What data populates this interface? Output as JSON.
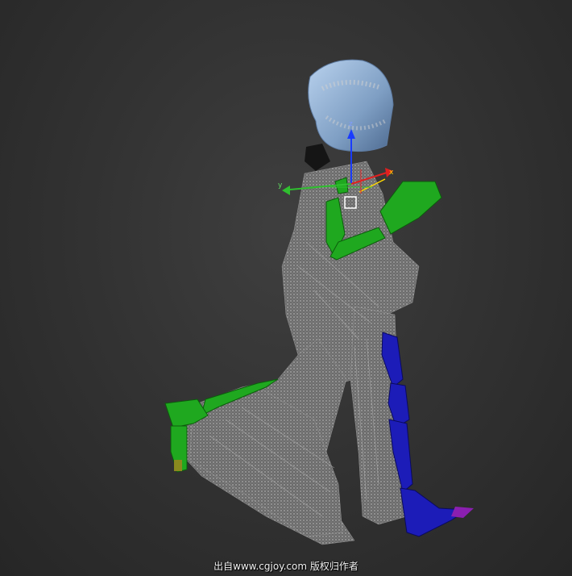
{
  "viewport": {
    "background": "#333333",
    "gizmo": {
      "axis_x_label": "x",
      "axis_y_label": "y",
      "axis_z_label": "z",
      "colors": {
        "x": "#e02020",
        "y": "#2fbf2f",
        "z": "#1a3cff",
        "highlight": "#ffd800"
      }
    },
    "rig_colors": {
      "left_side": "#1fa81f",
      "right_side": "#1f1fb0",
      "head": "#8fb2d8",
      "mesh": "#8c8c8c"
    }
  },
  "watermark": {
    "text": "出自www.cgjoy.com 版权归作者"
  }
}
